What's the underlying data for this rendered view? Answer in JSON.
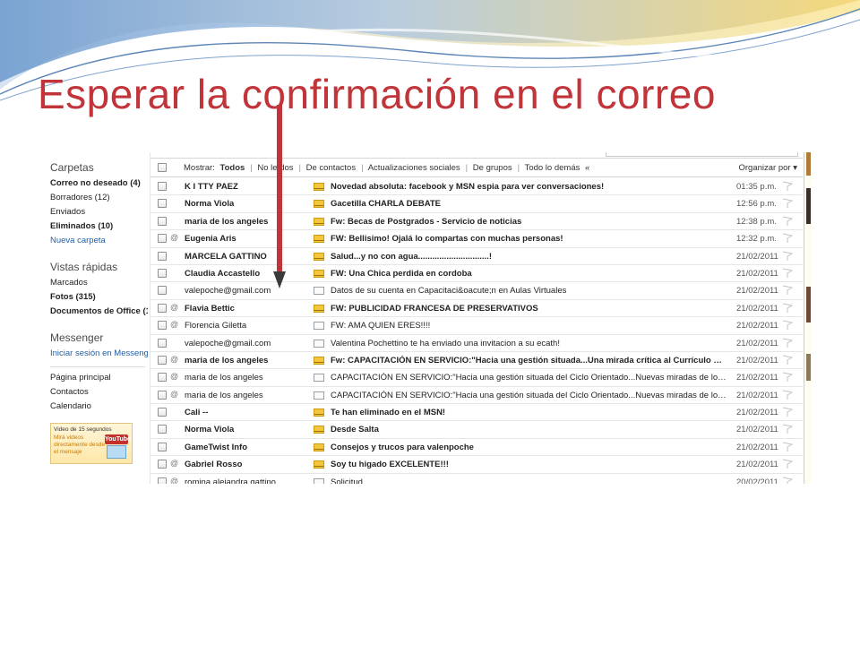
{
  "slide": {
    "title": "Esperar la confirmación en el correo",
    "title_color": "#c0343a"
  },
  "folders": {
    "carpetas_header": "Carpetas",
    "items": [
      {
        "label": "Correo no deseado (4)",
        "bold": true
      },
      {
        "label": "Borradores (12)",
        "bold": false
      },
      {
        "label": "Enviados",
        "bold": false
      },
      {
        "label": "Eliminados (10)",
        "bold": true
      },
      {
        "label": "Nueva carpeta",
        "bold": false,
        "link": true
      }
    ],
    "vistas_header": "Vistas rápidas",
    "vistas": [
      {
        "label": "Marcados",
        "bold": false
      },
      {
        "label": "Fotos (315)",
        "bold": true
      },
      {
        "label": "Documentos de Office (1",
        "bold": true
      }
    ],
    "messenger_header": "Messenger",
    "messenger_link": "Iniciar sesión en Messenge",
    "footer_links": [
      "Página principal",
      "Contactos",
      "Calendario"
    ],
    "promo": {
      "line1": "Video de 15 segundos",
      "line2": "Mirá videos directamente desde el mensaje",
      "badge": "YouTube"
    }
  },
  "filterbar": {
    "show_label": "Mostrar:",
    "options": [
      "Todos",
      "No leídos",
      "De contactos",
      "Actualizaciones sociales",
      "De grupos",
      "Todo lo demás"
    ],
    "more_glyph": "«",
    "organize_label": "Organizar por ▾"
  },
  "messages": [
    {
      "from": "K I TTY PAEZ",
      "subject": "Novedad absoluta: facebook y MSN espia para ver conversaciones!",
      "date": "01:35 p.m.",
      "unread": true,
      "attach": false
    },
    {
      "from": "Norma Viola",
      "subject": "Gacetilla CHARLA DEBATE",
      "date": "12:56 p.m.",
      "unread": true,
      "attach": false
    },
    {
      "from": "maria de los angeles",
      "subject": "Fw: Becas de Postgrados - Servicio de noticias",
      "date": "12:38 p.m.",
      "unread": true,
      "attach": false
    },
    {
      "from": "Eugenia Aris",
      "subject": "FW: Bellisimo! Ojalá lo compartas con muchas personas!",
      "date": "12:32 p.m.",
      "unread": true,
      "attach": true
    },
    {
      "from": "MARCELA GATTINO",
      "subject": "Salud...y no con agua..............................!",
      "date": "21/02/2011",
      "unread": true,
      "attach": false
    },
    {
      "from": "Claudia Accastello",
      "subject": "FW: Una Chica perdida en cordoba",
      "date": "21/02/2011",
      "unread": true,
      "attach": false
    },
    {
      "from": "valepoche@gmail.com",
      "subject": "Datos de su cuenta en Capacitaci&oacute;n en Aulas Virtuales",
      "date": "21/02/2011",
      "unread": false,
      "attach": false
    },
    {
      "from": "Flavia Bettic",
      "subject": "FW: PUBLICIDAD FRANCESA DE PRESERVATIVOS",
      "date": "21/02/2011",
      "unread": true,
      "attach": true
    },
    {
      "from": "Florencia Giletta",
      "subject": "FW: AMA QUIEN ERES!!!!",
      "date": "21/02/2011",
      "unread": false,
      "attach": true
    },
    {
      "from": "valepoche@gmail.com",
      "subject": "Valentina Pochettino te ha enviado una invitacion a su ecath!",
      "date": "21/02/2011",
      "unread": false,
      "attach": false
    },
    {
      "from": "maria de los angeles",
      "subject": "Fw: CAPACITACIÓN EN SERVICIO:\"Hacia una gestión situada...Una mirada crítica al Currículo de Educa...",
      "date": "21/02/2011",
      "unread": true,
      "attach": true
    },
    {
      "from": "maria de los angeles",
      "subject": "CAPACITACIÓN EN SERVICIO:\"Hacia una gestión situada del Ciclo Orientado...Nuevas miradas de los cont...",
      "date": "21/02/2011",
      "unread": false,
      "attach": true
    },
    {
      "from": "maria de los angeles",
      "subject": "CAPACITACIÓN EN SERVICIO:\"Hacia una gestión situada del Ciclo Orientado...Nuevas miradas de los cont...",
      "date": "21/02/2011",
      "unread": false,
      "attach": true
    },
    {
      "from": "Cali --",
      "subject": "Te han eliminado en el MSN!",
      "date": "21/02/2011",
      "unread": true,
      "attach": false
    },
    {
      "from": "Norma Viola",
      "subject": "Desde Salta",
      "date": "21/02/2011",
      "unread": true,
      "attach": false
    },
    {
      "from": "GameTwist Info",
      "subject": "Consejos y trucos para valenpoche",
      "date": "21/02/2011",
      "unread": true,
      "attach": false
    },
    {
      "from": "Gabriel Rosso",
      "subject": "Soy tu higado EXCELENTE!!!",
      "date": "21/02/2011",
      "unread": true,
      "attach": true
    },
    {
      "from": "romina alejandra gattino",
      "subject": "Solicitud",
      "date": "20/02/2011",
      "unread": false,
      "attach": true
    }
  ],
  "colors": {
    "accent_link": "#1f5fa8",
    "arrow": "#c0343a",
    "envelope_unread": "#f4c63c"
  }
}
